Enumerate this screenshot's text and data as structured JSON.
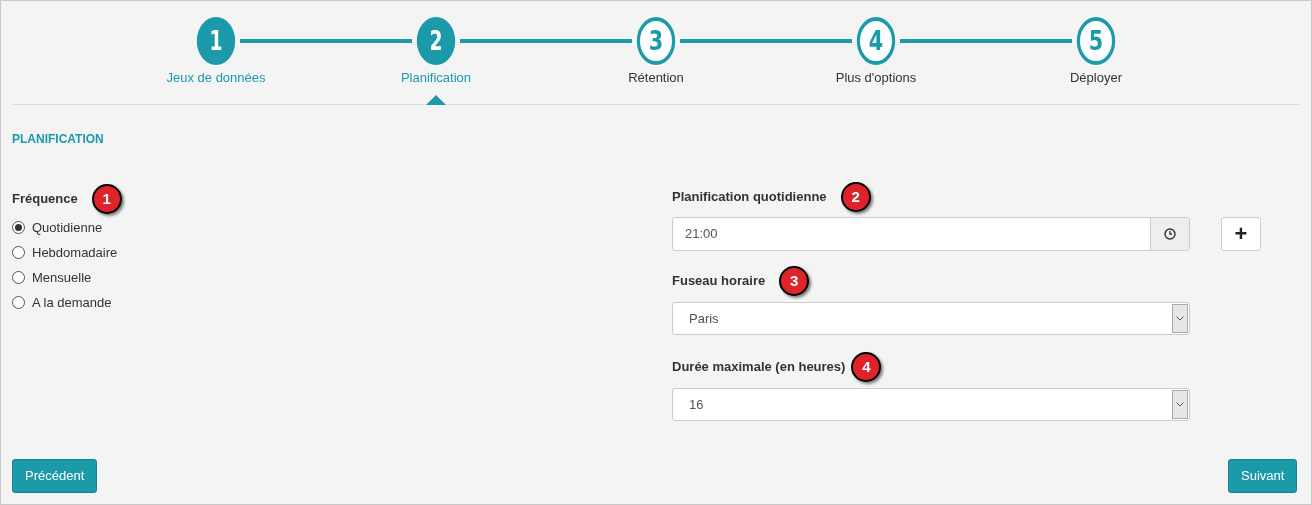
{
  "steps": [
    {
      "number": "1",
      "label": "Jeux de données",
      "reached": true,
      "selected": false
    },
    {
      "number": "2",
      "label": "Planification",
      "reached": true,
      "selected": true
    },
    {
      "number": "3",
      "label": "Rétention",
      "reached": false,
      "selected": false
    },
    {
      "number": "4",
      "label": "Plus d'options",
      "reached": false,
      "selected": false
    },
    {
      "number": "5",
      "label": "Déployer",
      "reached": false,
      "selected": false
    }
  ],
  "section_title": "PLANIFICATION",
  "frequency": {
    "label": "Fréquence",
    "callout": "1",
    "options": [
      {
        "label": "Quotidienne",
        "selected": true
      },
      {
        "label": "Hebdomadaire",
        "selected": false
      },
      {
        "label": "Mensuelle",
        "selected": false
      },
      {
        "label": "A la demande",
        "selected": false
      }
    ]
  },
  "daily_schedule": {
    "label": "Planification quotidienne",
    "callout": "2",
    "value": "21:00",
    "add_button": "+"
  },
  "timezone": {
    "label": "Fuseau horaire",
    "callout": "3",
    "value": "Paris"
  },
  "max_duration": {
    "label": "Durée maximale (en heures)",
    "callout": "4",
    "value": "16"
  },
  "buttons": {
    "previous": "Précédent",
    "next": "Suivant"
  }
}
